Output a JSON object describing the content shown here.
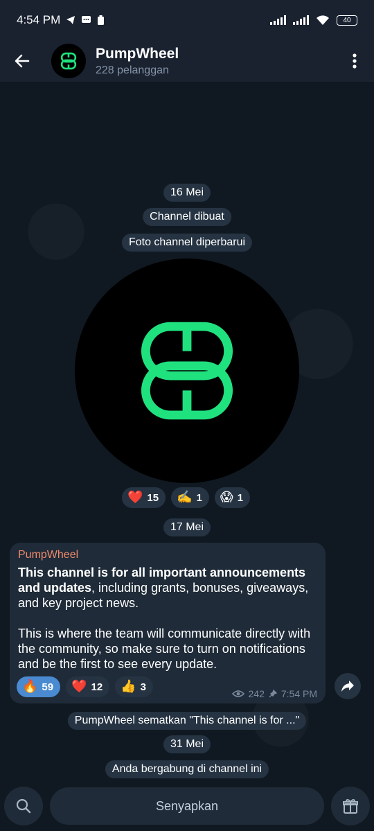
{
  "status": {
    "time": "4:54 PM",
    "battery": "40"
  },
  "header": {
    "title": "PumpWheel",
    "subtitle": "228 pelanggan"
  },
  "service": {
    "date1": "16 Mei",
    "created": "Channel dibuat",
    "photo_updated": "Foto channel diperbarui",
    "date2": "17 Mei",
    "pinned": "PumpWheel sematkan \"This channel is for ...\"",
    "date3": "31 Mei",
    "joined": "Anda bergabung di channel ini"
  },
  "photo_reactions": [
    {
      "emoji": "❤️",
      "count": "15"
    },
    {
      "emoji": "✍️",
      "count": "1"
    },
    {
      "emoji": "😱",
      "count": "1"
    }
  ],
  "message": {
    "author": "PumpWheel",
    "bold_text": "This channel is for all important announcements and updates",
    "text_rest": ", including grants, bonuses, giveaways, and key project news.",
    "paragraph2": "This is where the team will communicate directly with the community, so make sure to turn on notifications and be the first to see every update.",
    "views": "242",
    "time": "7:54 PM",
    "reactions": [
      {
        "emoji": "🔥",
        "count": "59"
      },
      {
        "emoji": "❤️",
        "count": "12"
      },
      {
        "emoji": "👍",
        "count": "3"
      }
    ]
  },
  "bottom": {
    "mute_label": "Senyapkan"
  },
  "colors": {
    "accent_green": "#1fe27f",
    "author": "#f08a6c",
    "active_reaction": "#4a8ad0"
  }
}
